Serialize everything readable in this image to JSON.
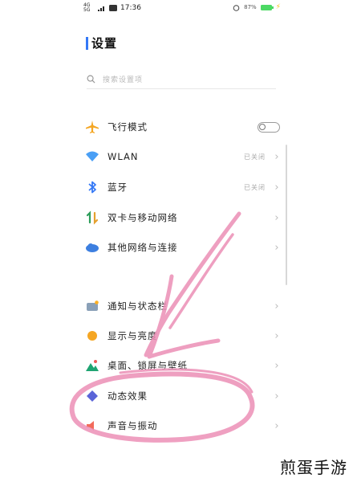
{
  "status_bar": {
    "network_4g": "4G",
    "network_5g": "5G",
    "time": "17:36",
    "battery_text": "87%"
  },
  "header": {
    "title": "设置"
  },
  "search": {
    "placeholder": "搜索设置项"
  },
  "groups": [
    {
      "items": [
        {
          "label": "飞行模式",
          "icon": "airplane-icon",
          "control": "toggle",
          "toggle_on": false
        },
        {
          "label": "WLAN",
          "icon": "wifi-icon",
          "value": "已关闭"
        },
        {
          "label": "蓝牙",
          "icon": "bluetooth-icon",
          "value": "已关闭"
        },
        {
          "label": "双卡与移动网络",
          "icon": "mobile-network-icon"
        },
        {
          "label": "其他网络与连接",
          "icon": "cloud-icon"
        }
      ]
    },
    {
      "items": [
        {
          "label": "通知与状态栏",
          "icon": "notification-icon"
        },
        {
          "label": "显示与亮度",
          "icon": "brightness-icon"
        },
        {
          "label": "桌面、锁屏与壁纸",
          "icon": "wallpaper-icon"
        },
        {
          "label": "动态效果",
          "icon": "dynamic-effects-icon"
        },
        {
          "label": "声音与振动",
          "icon": "sound-icon"
        }
      ]
    }
  ],
  "watermark": {
    "text": "煎蛋手游"
  },
  "colors": {
    "accent": "#3478f6",
    "annotation": "#ec8fb6",
    "toggle_off": "#9a9a9a"
  }
}
